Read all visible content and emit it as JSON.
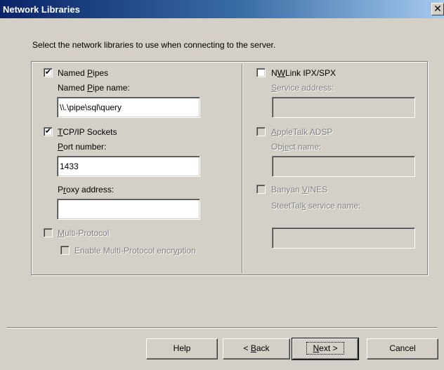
{
  "window": {
    "title": "Network Libraries",
    "close_glyph": "✕"
  },
  "instruction": "Select the network libraries to use when connecting to the server.",
  "left": {
    "named_pipes": {
      "label_pre": "Named ",
      "label_u": "P",
      "label_post": "ipes",
      "checked": true,
      "check_glyph": "✔",
      "field_label_pre": "Named ",
      "field_label_u": "P",
      "field_label_post": "ipe name:",
      "value": "\\\\.\\pipe\\sql\\query"
    },
    "tcpip": {
      "label_u": "T",
      "label_post": "CP/IP Sockets",
      "checked": true,
      "check_glyph": "✔",
      "port_label_pre": "",
      "port_label_u": "P",
      "port_label_post": "ort number:",
      "port_value": "1433",
      "proxy_label_pre": "P",
      "proxy_label_u": "r",
      "proxy_label_post": "oxy address:",
      "proxy_value": ""
    },
    "multi_protocol": {
      "label_u": "M",
      "label_post": "ulti-Protocol",
      "checked": false,
      "encryption_label_pre": "Enable Multi-Protocol encr",
      "encryption_label_u": "y",
      "encryption_label_post": "ption"
    }
  },
  "right": {
    "nwlink": {
      "label_pre": "N",
      "label_u": "W",
      "label_post": "Link IPX/SPX",
      "checked": false,
      "field_label_u": "S",
      "field_label_post": "ervice address:",
      "value": ""
    },
    "appletalk": {
      "label_u": "A",
      "label_post": "ppleTalk ADSP",
      "checked": false,
      "field_label_pre": "Obj",
      "field_label_u": "e",
      "field_label_post": "ct name:",
      "value": ""
    },
    "banyan": {
      "label_pre": "Banyan ",
      "label_u": "V",
      "label_post": "INES",
      "checked": false,
      "field_label_pre": "SteetTal",
      "field_label_u": "k",
      "field_label_post": " service name:",
      "value": ""
    }
  },
  "buttons": {
    "help": "Help",
    "back_pre": "< ",
    "back_u": "B",
    "back_post": "ack",
    "next_u": "N",
    "next_post": "ext >",
    "cancel": "Cancel"
  }
}
